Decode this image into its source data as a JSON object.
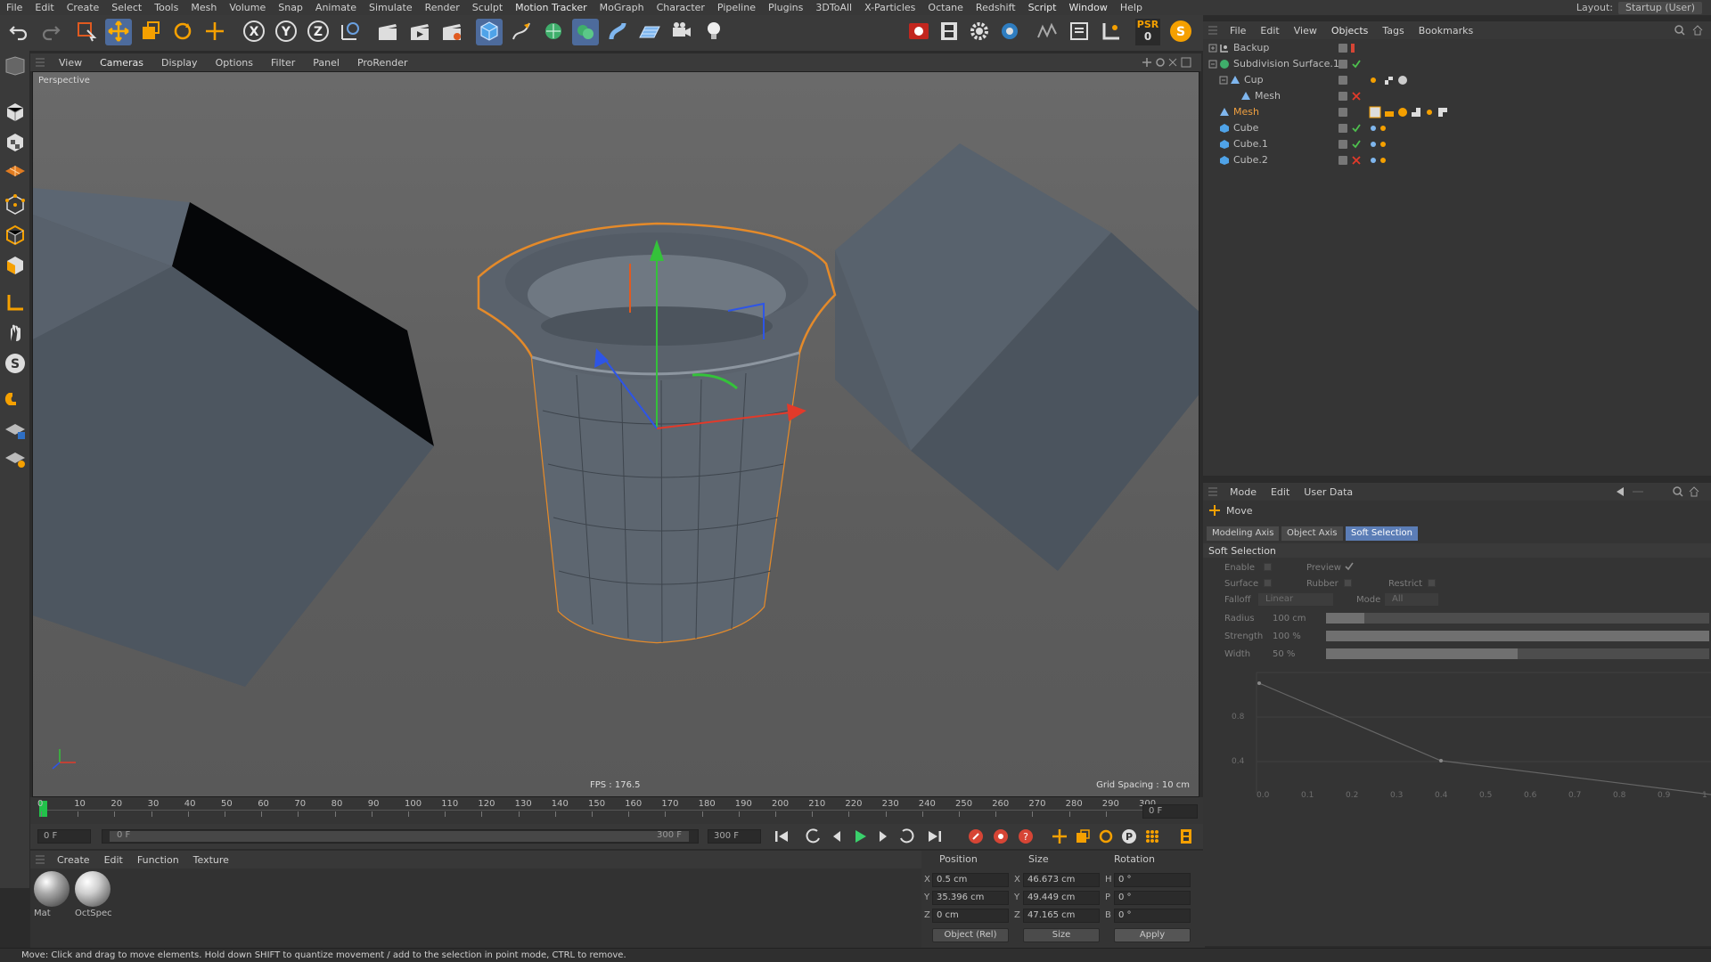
{
  "menubar": {
    "items": [
      "File",
      "Edit",
      "Create",
      "Select",
      "Tools",
      "Mesh",
      "Volume",
      "Snap",
      "Animate",
      "Simulate",
      "Render",
      "Sculpt",
      "Motion Tracker",
      "MoGraph",
      "Character",
      "Pipeline",
      "Plugins",
      "3DToAll",
      "X-Particles",
      "Octane",
      "Redshift",
      "Script",
      "Window",
      "Help"
    ],
    "layout_label": "Layout:",
    "layout_value": "Startup (User)"
  },
  "toolbar": {
    "psr_label": "PSR",
    "psr_value": "0",
    "axis_x": "X",
    "axis_y": "Y",
    "axis_z": "Z"
  },
  "viewport": {
    "menu": [
      "View",
      "Cameras",
      "Display",
      "Options",
      "Filter",
      "Panel",
      "ProRender"
    ],
    "label": "Perspective",
    "fps": "FPS : 176.5",
    "grid_spacing": "Grid Spacing : 10 cm"
  },
  "timeline": {
    "ticks": [
      "0",
      "10",
      "20",
      "30",
      "40",
      "50",
      "60",
      "70",
      "80",
      "90",
      "100",
      "110",
      "120",
      "130",
      "140",
      "150",
      "160",
      "170",
      "180",
      "190",
      "200",
      "210",
      "220",
      "230",
      "240",
      "250",
      "260",
      "270",
      "280",
      "290",
      "300"
    ],
    "current_frame": "0 F",
    "start_frame": "0 F",
    "range_start": "0 F",
    "range_end": "300 F",
    "end_frame": "300 F"
  },
  "materials": {
    "menu": [
      "Create",
      "Edit",
      "Function",
      "Texture"
    ],
    "items": [
      {
        "name": "Mat"
      },
      {
        "name": "OctSpec"
      }
    ]
  },
  "coordinates": {
    "headers": {
      "position": "Position",
      "size": "Size",
      "rotation": "Rotation"
    },
    "rows": [
      {
        "axis": "X",
        "pos": "0.5 cm",
        "size_axis": "X",
        "size": "46.673 cm",
        "rot_axis": "H",
        "rot": "0 °"
      },
      {
        "axis": "Y",
        "pos": "35.396 cm",
        "size_axis": "Y",
        "size": "49.449 cm",
        "rot_axis": "P",
        "rot": "0 °"
      },
      {
        "axis": "Z",
        "pos": "0 cm",
        "size_axis": "Z",
        "size": "47.165 cm",
        "rot_axis": "B",
        "rot": "0 °"
      }
    ],
    "mode_select": "Object (Rel)",
    "size_select": "Size",
    "apply": "Apply"
  },
  "status": "Move: Click and drag to move elements. Hold down SHIFT to quantize movement / add to the selection in point mode, CTRL to remove.",
  "objects": {
    "menu": [
      "File",
      "Edit",
      "View",
      "Objects",
      "Tags",
      "Bookmarks"
    ],
    "rows": [
      {
        "name": "Backup",
        "indent": 0,
        "selected": false
      },
      {
        "name": "Subdivision Surface.1",
        "indent": 0,
        "selected": false
      },
      {
        "name": "Cup",
        "indent": 1,
        "selected": false
      },
      {
        "name": "Mesh",
        "indent": 2,
        "selected": false
      },
      {
        "name": "Mesh",
        "indent": 0,
        "selected": true
      },
      {
        "name": "Cube",
        "indent": 0,
        "selected": false
      },
      {
        "name": "Cube.1",
        "indent": 0,
        "selected": false
      },
      {
        "name": "Cube.2",
        "indent": 0,
        "selected": false
      }
    ]
  },
  "attributes": {
    "menu": [
      "Mode",
      "Edit",
      "User Data"
    ],
    "tool_name": "Move",
    "tabs": [
      "Modeling Axis",
      "Object Axis",
      "Soft Selection"
    ],
    "active_tab": "Soft Selection",
    "section": "Soft Selection",
    "enable": "Enable",
    "preview": "Preview",
    "surface": "Surface",
    "rubber": "Rubber",
    "restrict": "Restrict",
    "falloff": "Falloff",
    "falloff_value": "Linear",
    "mode": "Mode",
    "mode_value": "All",
    "radius": "Radius",
    "radius_value": "100 cm",
    "strength": "Strength",
    "strength_value": "100 %",
    "width": "Width",
    "width_value": "50 %",
    "radius_fill": 0.1,
    "strength_fill": 1.0,
    "width_fill": 0.5,
    "graph": {
      "y_ticks": [
        "0.8",
        "0.4"
      ],
      "x_ticks": [
        "0.0",
        "0.1",
        "0.2",
        "0.3",
        "0.4",
        "0.5",
        "0.6",
        "0.7",
        "0.8",
        "0.9",
        "1"
      ]
    }
  },
  "colors": {
    "selection": "#f0a040",
    "active_tab": "#5b7db6",
    "axis_x": "#e23a2a",
    "axis_y": "#34c23a",
    "axis_z": "#2e55e6"
  }
}
